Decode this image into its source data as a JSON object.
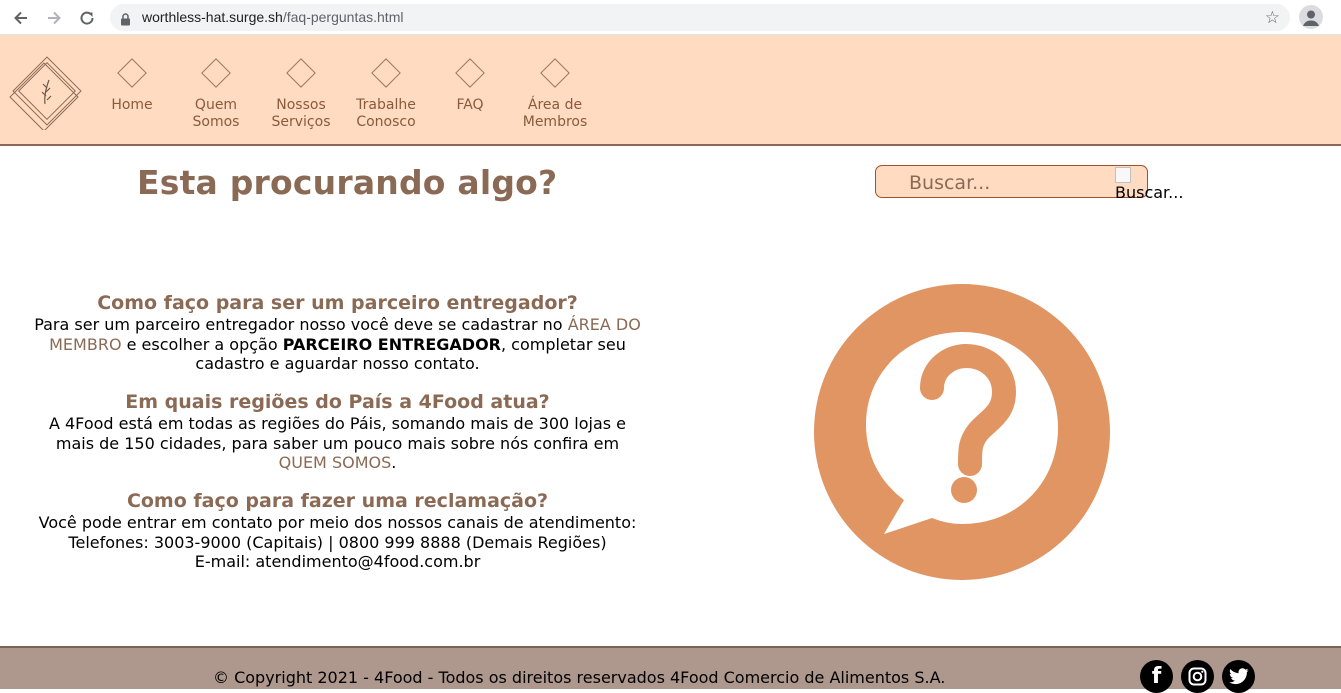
{
  "browser": {
    "url_domain": "worthless-hat.surge.sh",
    "url_path": "/faq-perguntas.html"
  },
  "nav": {
    "items": [
      {
        "label": "Home"
      },
      {
        "label": "Quem Somos"
      },
      {
        "label": "Nossos Serviços"
      },
      {
        "label": "Trabalhe Conosco"
      },
      {
        "label": "FAQ"
      },
      {
        "label": "Área de Membros"
      }
    ]
  },
  "main": {
    "title": "Esta procurando algo?",
    "search": {
      "placeholder": "Buscar...",
      "button_alt": "Buscar..."
    },
    "faq": [
      {
        "question": "Como faço para ser um parceiro entregador?",
        "answer_part1": "Para ser um parceiro entregador nosso você deve se cadastrar no ",
        "answer_link": "ÁREA DO MEMBRO",
        "answer_part2": " e escolher a opção ",
        "answer_bold": "PARCEIRO ENTREGADOR",
        "answer_part3": ", completar seu cadastro e aguardar nosso contato."
      },
      {
        "question": "Em quais regiões do País a 4Food atua?",
        "answer_part1": "A 4Food está em todas as regiões do Páis, somando mais de 300 lojas e mais de 150 cidades, para saber um pouco mais sobre nós confira em ",
        "answer_link": "QUEM SOMOS",
        "answer_part2": "."
      },
      {
        "question": "Como faço para fazer uma reclamação?",
        "answer_line1": "Você pode entrar em contato por meio dos nossos canais de atendimento:",
        "answer_line2": "Telefones: 3003-9000 (Capitais) | 0800 999 8888 (Demais Regiões)",
        "answer_line3": "E-mail: atendimento@4food.com.br"
      }
    ]
  },
  "footer": {
    "copyright": "© Copyright 2021 - 4Food - Todos os direitos reservados 4Food Comercio de Alimentos S.A.",
    "social": [
      {
        "icon": "facebook-icon",
        "glyph": "f"
      },
      {
        "icon": "instagram-icon",
        "glyph": "◎"
      },
      {
        "icon": "twitter-icon",
        "glyph": "🐦"
      }
    ]
  },
  "colors": {
    "header_bg": "#ffdbc1",
    "accent_brown": "#8b6a55",
    "question_orange": "#e09563",
    "footer_bg": "#ae978c"
  }
}
